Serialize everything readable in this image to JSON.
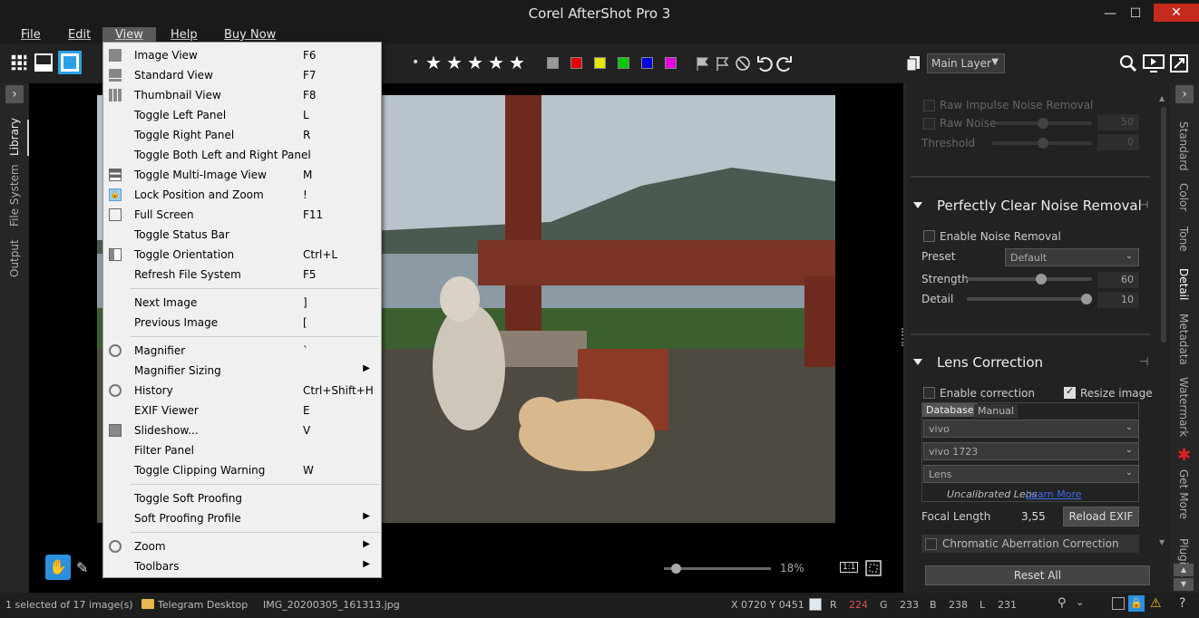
{
  "app": {
    "title": "Corel AfterShot Pro 3"
  },
  "window": {
    "minimize": "—",
    "maximize": "☐",
    "close": "✕"
  },
  "menubar": {
    "file": "File",
    "edit": "Edit",
    "view": "View",
    "help": "Help",
    "buy": "Buy Now"
  },
  "toolbar": {
    "layer": "Main Layer",
    "dot": "•",
    "stars": [
      "★",
      "★",
      "★",
      "★",
      "★"
    ],
    "colors": [
      "#9a9a9a",
      "#e00000",
      "#e6e600",
      "#00c800",
      "#0000e0",
      "#e000e0"
    ],
    "icons": [
      "thumbnail-grid-icon",
      "standard-view-icon",
      "image-view-icon",
      "flag-icon",
      "flag-outline-icon",
      "reject-flag-icon",
      "rotate-left-icon",
      "rotate-right-icon",
      "copy-icon",
      "search-icon",
      "slideshow-icon",
      "fullscreen-icon"
    ]
  },
  "left_tabs": [
    "Library",
    "File System",
    "Output"
  ],
  "right_tabs": [
    "Standard",
    "Color",
    "Tone",
    "Detail",
    "Metadata",
    "Watermark",
    "Get More",
    "Plugins"
  ],
  "view_menu": {
    "items": [
      {
        "label": "Image View",
        "key": "F6",
        "icon": "image-view-icon"
      },
      {
        "label": "Standard View",
        "key": "F7",
        "icon": "standard-view-icon"
      },
      {
        "label": "Thumbnail View",
        "key": "F8",
        "icon": "thumbnail-view-icon"
      },
      {
        "label": "Toggle Left Panel",
        "key": "L"
      },
      {
        "label": "Toggle Right Panel",
        "key": "R"
      },
      {
        "label": "Toggle Both Left and Right Panel",
        "key": ""
      },
      {
        "label": "Toggle Multi-Image View",
        "key": "M",
        "icon": "multi-image-icon"
      },
      {
        "label": "Lock Position and Zoom",
        "key": "!",
        "icon": "lock-icon"
      },
      {
        "label": "Full Screen",
        "key": "F11",
        "icon": "fullscreen-icon"
      },
      {
        "label": "Toggle Status Bar",
        "key": ""
      },
      {
        "label": "Toggle Orientation",
        "key": "Ctrl+L",
        "icon": "orientation-icon"
      },
      {
        "label": "Refresh File System",
        "key": "F5"
      },
      {
        "label": "Next Image",
        "key": "]"
      },
      {
        "label": "Previous Image",
        "key": "["
      },
      {
        "label": "Magnifier",
        "key": "`",
        "icon": "magnifier-icon"
      },
      {
        "label": "Magnifier Sizing",
        "key": "",
        "submenu": "▶"
      },
      {
        "label": "History",
        "key": "Ctrl+Shift+H",
        "icon": "history-icon"
      },
      {
        "label": "EXIF Viewer",
        "key": "E"
      },
      {
        "label": "Slideshow...",
        "key": "V",
        "icon": "slideshow-icon"
      },
      {
        "label": "Filter Panel",
        "key": ""
      },
      {
        "label": "Toggle Clipping Warning",
        "key": "W"
      },
      {
        "label": "Toggle Soft Proofing",
        "key": ""
      },
      {
        "label": "Soft Proofing Profile",
        "key": "",
        "submenu": "▶"
      },
      {
        "label": "Zoom",
        "key": "",
        "submenu": "▶",
        "icon": "zoom-icon"
      },
      {
        "label": "Toolbars",
        "key": "",
        "submenu": "▶"
      }
    ]
  },
  "noise_section": {
    "raw_impulse": "Raw Impulse Noise Removal",
    "raw_noise": "Raw Noise",
    "raw_noise_val": "50",
    "threshold": "Threshold",
    "threshold_val": "0"
  },
  "perfectly_clear": {
    "title": "Perfectly Clear Noise Removal",
    "enable": "Enable Noise Removal",
    "preset_label": "Preset",
    "preset_value": "Default",
    "strength_label": "Strength",
    "strength_value": "60",
    "detail_label": "Detail",
    "detail_value": "10"
  },
  "lens": {
    "title": "Lens Correction",
    "enable": "Enable correction",
    "resize": "Resize image",
    "tab_database": "Database",
    "tab_manual": "Manual",
    "make": "vivo",
    "model": "vivo 1723",
    "lens": "Lens",
    "uncalibrated": "Uncalibrated Lens",
    "learn_more": "Learn More",
    "focal_label": "Focal Length",
    "focal_value": "3,55",
    "reload": "Reload EXIF",
    "chromatic": "Chromatic Aberration Correction"
  },
  "reset_all": "Reset All",
  "viewer": {
    "zoom": "18%",
    "one_to_one": "1:1"
  },
  "statusbar": {
    "selected": "1 selected of 17 image(s)",
    "folder": "Telegram Desktop",
    "filename": "IMG_20200305_161313.jpg",
    "coords": "X 0720  Y 0451",
    "r_label": "R",
    "r_val": "224",
    "g_label": "G",
    "g_val": "233",
    "b_label": "B",
    "b_val": "238",
    "l_label": "L",
    "l_val": "231"
  }
}
